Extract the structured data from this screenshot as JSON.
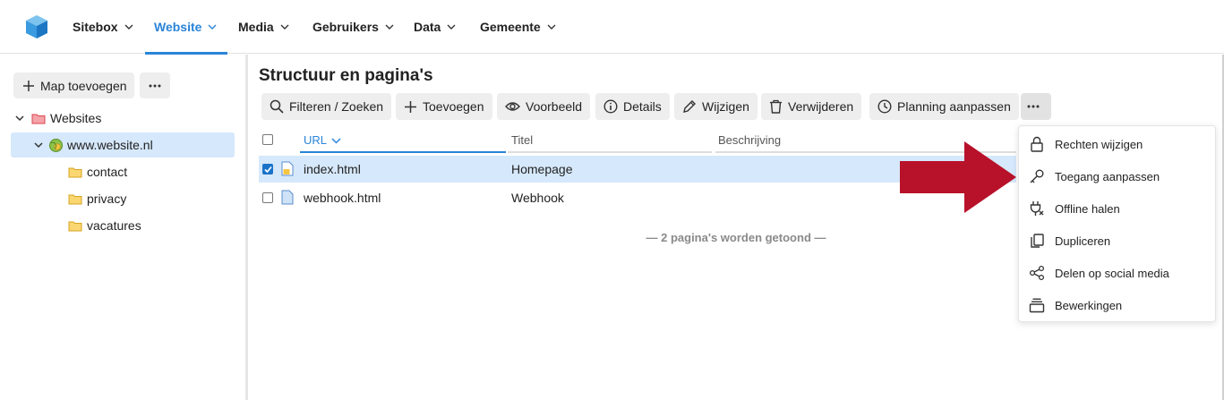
{
  "nav": {
    "items": [
      {
        "label": "Sitebox"
      },
      {
        "label": "Website"
      },
      {
        "label": "Media"
      },
      {
        "label": "Gebruikers"
      },
      {
        "label": "Data"
      },
      {
        "label": "Gemeente"
      }
    ],
    "active": "Website"
  },
  "sidebar": {
    "add_folder_label": "Map toevoegen",
    "more_label": "...",
    "tree": [
      {
        "label": "Websites"
      },
      {
        "label": "www.website.nl"
      },
      {
        "label": "contact"
      },
      {
        "label": "privacy"
      },
      {
        "label": "vacatures"
      }
    ]
  },
  "main": {
    "title": "Structuur en pagina's",
    "toolbar": [
      {
        "label": "Filteren / Zoeken",
        "icon": "search-icon"
      },
      {
        "label": "Toevoegen",
        "icon": "plus-icon"
      },
      {
        "label": "Voorbeeld",
        "icon": "eye-icon"
      },
      {
        "label": "Details",
        "icon": "info-icon"
      },
      {
        "label": "Wijzigen",
        "icon": "pencil-icon"
      },
      {
        "label": "Verwijderen",
        "icon": "trash-icon"
      },
      {
        "label": "Planning aanpassen",
        "icon": "clock-icon"
      }
    ],
    "table": {
      "columns": [
        "URL",
        "Titel",
        "Beschrijving"
      ],
      "sort_column": "URL",
      "rows": [
        {
          "url": "index.html",
          "title": "Homepage",
          "description": "",
          "checked": true
        },
        {
          "url": "webhook.html",
          "title": "Webhook",
          "description": "",
          "checked": false
        }
      ],
      "footer": "— 2 pagina's worden getoond —"
    }
  },
  "menu": {
    "items": [
      {
        "label": "Rechten wijzigen",
        "icon": "lock-icon"
      },
      {
        "label": "Toegang aanpassen",
        "icon": "key-icon"
      },
      {
        "label": "Offline halen",
        "icon": "unplug-icon"
      },
      {
        "label": "Dupliceren",
        "icon": "copy-icon"
      },
      {
        "label": "Delen op social media",
        "icon": "share-icon"
      },
      {
        "label": "Bewerkingen",
        "icon": "layers-icon"
      }
    ]
  },
  "colors": {
    "accent": "#2a84d8",
    "selected_row": "#d6e8fb",
    "arrow": "#b8112a"
  }
}
